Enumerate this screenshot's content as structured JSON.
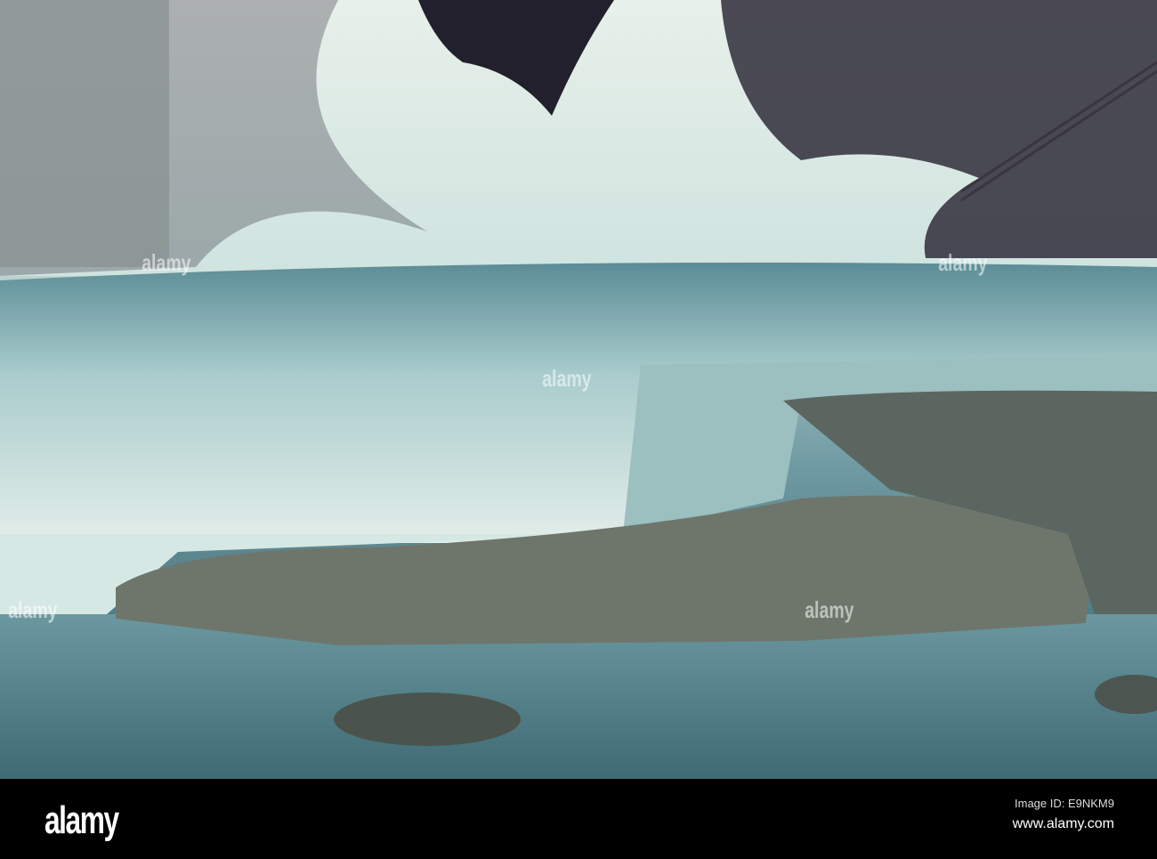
{
  "photo": {
    "subject": "waterfall",
    "palette": {
      "mist": "#d9e6df",
      "water": "#5e8890",
      "rock": "#5f6a63",
      "foliage": "#2c2a3a"
    }
  },
  "watermark": {
    "text": "alamy"
  },
  "footer": {
    "logo": "alamy",
    "image_id": "Image ID: E9NKM9",
    "url": "www.alamy.com"
  }
}
